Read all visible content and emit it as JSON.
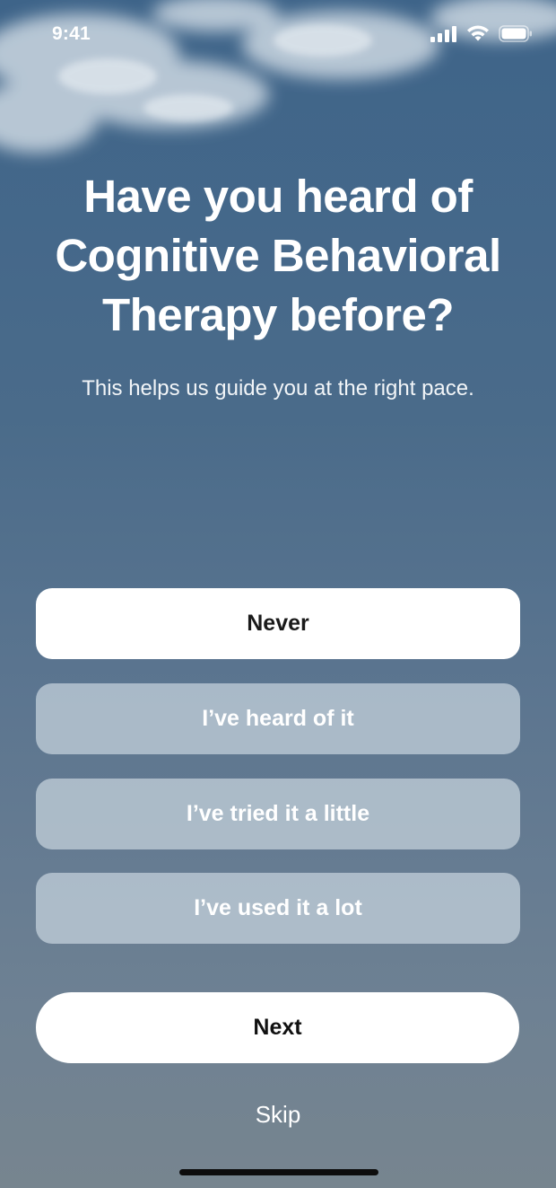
{
  "status_bar": {
    "time": "9:41",
    "icons": [
      "cellular-signal-icon",
      "wifi-icon",
      "battery-icon"
    ]
  },
  "question": {
    "title": "Have you heard of\nCognitive Behavioral\nTherapy before?",
    "subtitle": "This helps us guide you at the right pace."
  },
  "options": [
    {
      "label": "Never",
      "selected": true
    },
    {
      "label": "I’ve heard of it",
      "selected": false
    },
    {
      "label": "I’ve tried it a little",
      "selected": false
    },
    {
      "label": "I’ve used it a lot",
      "selected": false
    }
  ],
  "actions": {
    "next_label": "Next",
    "skip_label": "Skip"
  },
  "colors": {
    "background_top": "#3e6489",
    "background_bottom": "#77858f",
    "selected_option": "#ffffff",
    "unselected_option": "#b3c0cb"
  }
}
